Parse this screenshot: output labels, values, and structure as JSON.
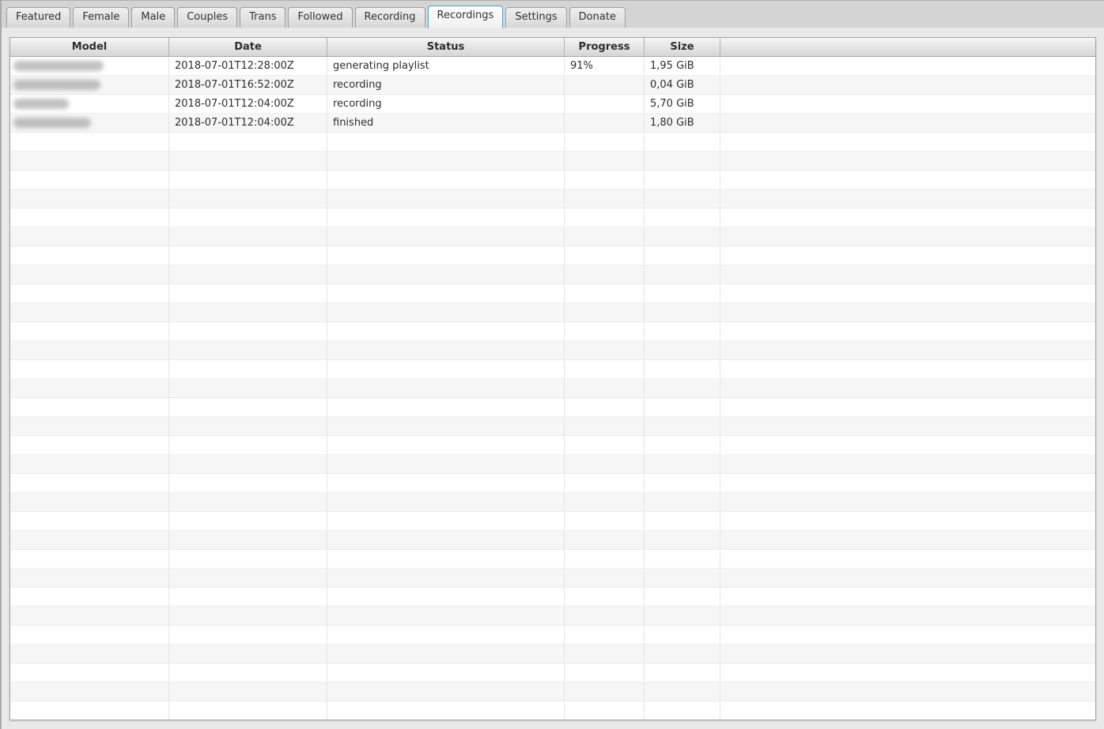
{
  "tab_bar": {
    "active_tab": "Recordings",
    "tabs": [
      {
        "label": "Featured",
        "active": false
      },
      {
        "label": "Female",
        "active": false
      },
      {
        "label": "Male",
        "active": false
      },
      {
        "label": "Couples",
        "active": false
      },
      {
        "label": "Trans",
        "active": false
      },
      {
        "label": "Followed",
        "active": false
      },
      {
        "label": "Recording",
        "active": false
      },
      {
        "label": "Recordings",
        "active": true
      },
      {
        "label": "Settings",
        "active": false
      },
      {
        "label": "Donate",
        "active": false
      }
    ]
  },
  "table": {
    "columns": [
      {
        "id": "model",
        "label": "Model"
      },
      {
        "id": "date",
        "label": "Date"
      },
      {
        "id": "status",
        "label": "Status"
      },
      {
        "id": "progress",
        "label": "Progress"
      },
      {
        "id": "size",
        "label": "Size"
      },
      {
        "id": "spacer",
        "label": ""
      }
    ],
    "rows": [
      {
        "model": "",
        "model_redacted": true,
        "redaction_width": 114,
        "date": "2018-07-01T12:28:00Z",
        "status": "generating playlist",
        "progress": "91%",
        "size": "1,95 GiB"
      },
      {
        "model": "",
        "model_redacted": true,
        "redaction_width": 110,
        "date": "2018-07-01T16:52:00Z",
        "status": "recording",
        "progress": "",
        "size": "0,04 GiB"
      },
      {
        "model": "",
        "model_redacted": true,
        "redaction_width": 70,
        "date": "2018-07-01T12:04:00Z",
        "status": "recording",
        "progress": "",
        "size": "5,70 GiB"
      },
      {
        "model": "",
        "model_redacted": true,
        "redaction_width": 98,
        "date": "2018-07-01T12:04:00Z",
        "status": "finished",
        "progress": "",
        "size": "1,80 GiB"
      }
    ],
    "empty_rows": 31
  },
  "colors": {
    "active_tab_border": "#55a2c8",
    "row_alt": "#f6f6f6",
    "window_background": "#d4d4d4",
    "content_background": "#e9e9e9",
    "header_text": "#2d2d2d"
  }
}
